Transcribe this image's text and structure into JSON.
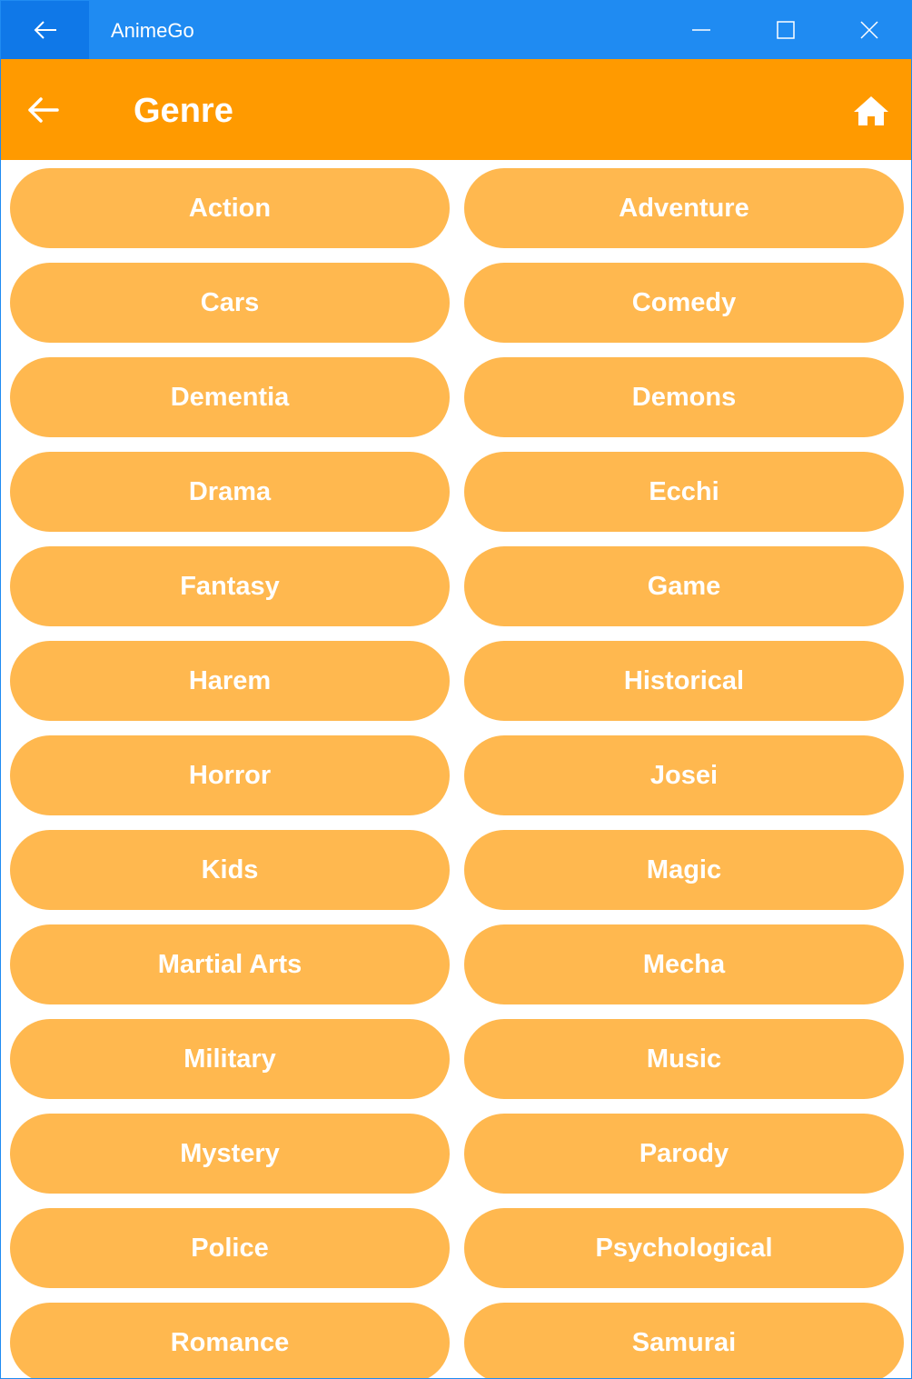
{
  "window": {
    "title": "AnimeGo"
  },
  "header": {
    "title": "Genre"
  },
  "genres": [
    "Action",
    "Adventure",
    "Cars",
    "Comedy",
    "Dementia",
    "Demons",
    "Drama",
    "Ecchi",
    "Fantasy",
    "Game",
    "Harem",
    "Historical",
    "Horror",
    "Josei",
    "Kids",
    "Magic",
    "Martial Arts",
    "Mecha",
    "Military",
    "Music",
    "Mystery",
    "Parody",
    "Police",
    "Psychological",
    "Romance",
    "Samurai"
  ],
  "colors": {
    "titlebar": "#1f8bf2",
    "titlebar_back": "#0f78e8",
    "header": "#ff9a00",
    "genre_button": "#ffb84f",
    "text": "#ffffff"
  },
  "icons": {
    "titlebar_back": "arrow-left-icon",
    "minimize": "minimize-icon",
    "maximize": "maximize-icon",
    "close": "close-icon",
    "app_back": "arrow-left-icon",
    "home": "home-icon"
  }
}
